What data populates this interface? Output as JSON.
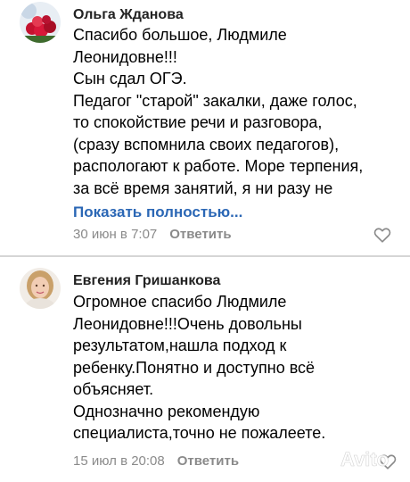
{
  "comments": [
    {
      "author": "Ольга Жданова",
      "lines": [
        "Спасибо большое, Людмиле",
        "Леонидовне!!!",
        "Сын сдал ОГЭ.",
        "Педагог \"старой\" закалки, даже голос,",
        "то спокойствие речи и разговора,",
        "(сразу вспомнила своих педагогов),",
        "распологают к работе. Море терпения,",
        "за всё время занятий, я ни разу не"
      ],
      "show_more": "Показать полностью...",
      "date": "30 июн в 7:07",
      "reply": "Ответить",
      "like_icon": "heart-outline-icon"
    },
    {
      "author": "Евгения Гришанкова",
      "lines": [
        "Огромное спасибо Людмиле",
        "Леонидовне!!!Очень довольны",
        "результатом,нашла подход к",
        "ребенку.Понятно и доступно всё",
        "объясняет.",
        "Однозначно рекомендую",
        "специалиста,точно не пожалеете."
      ],
      "date": "15 июл в 20:08",
      "reply": "Ответить",
      "like_icon": "heart-outline-icon"
    }
  ],
  "colors": {
    "link": "#2b67b5",
    "meta": "#8a8a8a",
    "divider": "#d5d5d5"
  },
  "watermark": "Avito"
}
